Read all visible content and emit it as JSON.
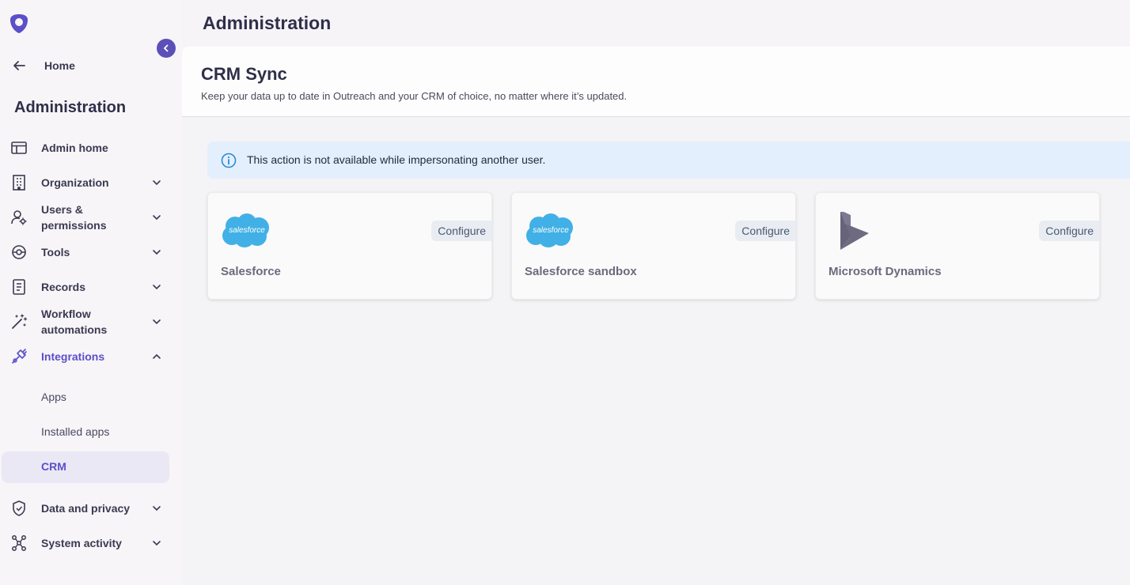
{
  "colors": {
    "accent": "#5a4fc9",
    "salesforce_blue": "#41b0e6",
    "dynamics_gray": "#6e6a80",
    "alert_bg": "#e4effd",
    "info_icon": "#2a8ad4"
  },
  "sidebar": {
    "logo_icon": "outreach-shield-logo",
    "collapse_icon": "chevron-left-icon",
    "home_label": "Home",
    "title": "Administration",
    "items": [
      {
        "label": "Admin home",
        "icon": "layout-icon"
      },
      {
        "label": "Organization",
        "icon": "building-icon"
      },
      {
        "label": "Users &",
        "label2": "permissions",
        "icon": "user-gear-icon"
      },
      {
        "label": "Tools",
        "icon": "tools-icon"
      },
      {
        "label": "Records",
        "icon": "document-icon"
      },
      {
        "label": "Workflow",
        "label2": "automations",
        "icon": "magic-wand-icon"
      },
      {
        "label": "Integrations",
        "icon": "plug-icon"
      },
      {
        "label": "Data and privacy",
        "icon": "shield-icon"
      },
      {
        "label": "System activity",
        "icon": "network-icon"
      }
    ],
    "sub_items": [
      {
        "label": "Apps"
      },
      {
        "label": "Installed apps"
      },
      {
        "label": "CRM"
      }
    ]
  },
  "main": {
    "page_title": "Administration",
    "header": {
      "title": "CRM Sync",
      "description": "Keep your data up to date in Outreach and your CRM of choice, no matter where it’s updated."
    },
    "alert": {
      "icon": "info-icon",
      "text": "This action is not available while impersonating another user."
    },
    "cards": [
      {
        "name": "Salesforce",
        "logo_text": "salesforce",
        "logo": "salesforce-cloud-logo",
        "button": "Configure"
      },
      {
        "name": "Salesforce sandbox",
        "logo_text": "salesforce",
        "logo": "salesforce-cloud-logo",
        "button": "Configure"
      },
      {
        "name": "Microsoft Dynamics",
        "logo": "dynamics-logo",
        "button": "Configure"
      }
    ]
  }
}
